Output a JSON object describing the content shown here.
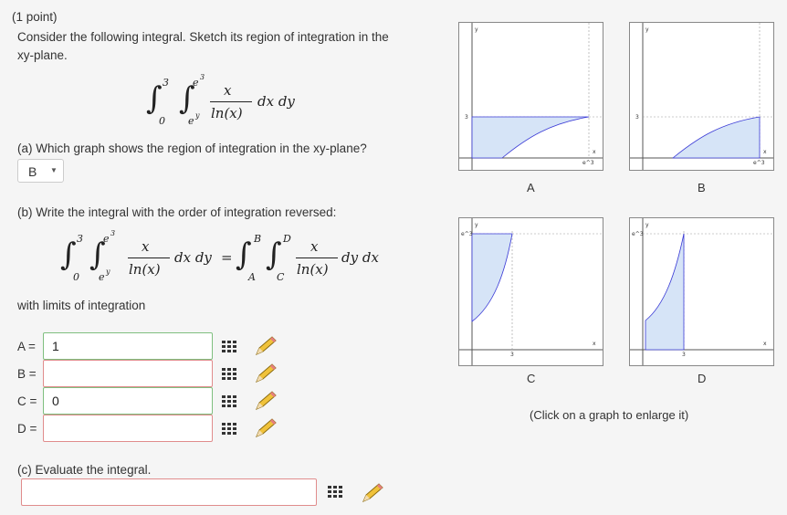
{
  "points": "(1 point)",
  "intro_line1": "Consider the following integral. Sketch its region of integration in the",
  "intro_line2": "xy-plane.",
  "integral": {
    "outer_lower": "0",
    "outer_upper": "3",
    "inner_lower": "e",
    "inner_lower_sup": "y",
    "inner_upper": "e",
    "inner_upper_sup": "3",
    "numerator": "x",
    "denominator": "ln(x)",
    "differentials": "dx dy"
  },
  "part_a": {
    "question": "(a) Which graph shows the region of integration in the xy-plane?",
    "selected": "B",
    "caret": "▼"
  },
  "part_b": {
    "question": "(b) Write the integral with the order of integration reversed:",
    "reversed": {
      "outer_lower": "A",
      "outer_upper": "B",
      "inner_lower": "C",
      "inner_upper": "D",
      "numerator": "x",
      "denominator": "ln(x)",
      "differentials": "dy dx",
      "equals": "="
    },
    "limits_label": "with limits of integration"
  },
  "fields": [
    {
      "label": "A =",
      "value": "1"
    },
    {
      "label": "B =",
      "value": ""
    },
    {
      "label": "C =",
      "value": "0"
    },
    {
      "label": "D =",
      "value": ""
    }
  ],
  "part_c": {
    "question": "(c) Evaluate the integral.",
    "value": ""
  },
  "graphs": {
    "A": {
      "label": "A",
      "y_axis": "y",
      "x_axis": "x",
      "y_tick": "3",
      "x_tick": "e^3"
    },
    "B": {
      "label": "B",
      "y_axis": "y",
      "x_axis": "x",
      "y_tick": "3",
      "x_tick": "e^3"
    },
    "C": {
      "label": "C",
      "y_axis": "y",
      "x_axis": "x",
      "y_tick": "e^3",
      "x_tick": "3"
    },
    "D": {
      "label": "D",
      "y_axis": "y",
      "x_axis": "x",
      "y_tick": "e^3",
      "x_tick": "3"
    }
  },
  "click_hint": "(Click on a graph to enlarge it)",
  "colors": {
    "region_fill": "#d6e4f7",
    "region_stroke": "#3a3ad6",
    "invalid_border": "#e08c8c",
    "valid_border": "#7fbf7f"
  },
  "icons": {
    "grid": "grid-icon",
    "edit": "pencil-icon"
  }
}
